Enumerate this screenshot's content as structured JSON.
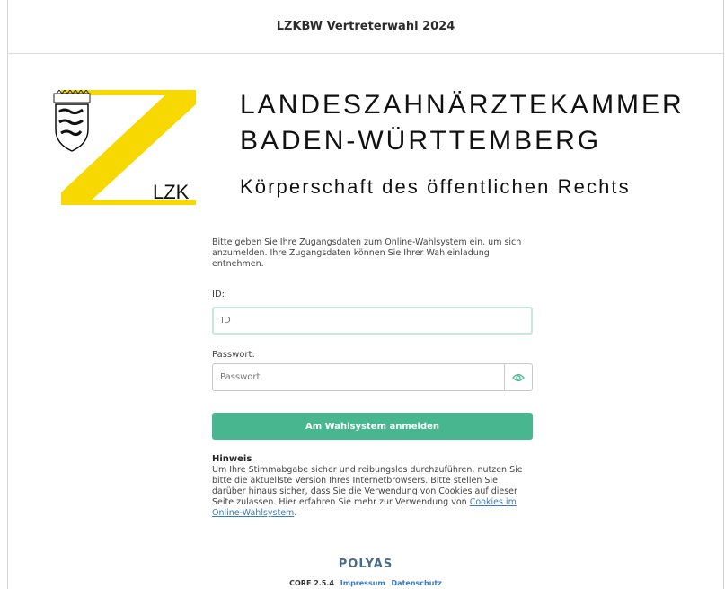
{
  "header": {
    "title": "LZKBW Vertreterwahl 2024"
  },
  "logo": {
    "text": "LZK",
    "brand_color": "#f7d800"
  },
  "organization": {
    "line1": "LANDESZAHNÄRZTEKAMMER",
    "line2": "BADEN-WÜRTTEMBERG",
    "line3": "Körperschaft des öffentlichen Rechts"
  },
  "login": {
    "intro": "Bitte geben Sie Ihre Zugangsdaten zum Online-Wahlsystem ein, um sich anzumelden. Ihre Zugangsdaten können Sie Ihrer Wahleinladung entnehmen.",
    "id_label": "ID:",
    "id_placeholder": "ID",
    "password_label": "Passwort:",
    "password_placeholder": "Passwort",
    "password_toggle_icon": "eye-icon",
    "submit_label": "Am Wahlsystem anmelden",
    "accent_color": "#48b68e"
  },
  "notice": {
    "title": "Hinweis",
    "text": "Um Ihre Stimmabgabe sicher und reibungslos durchzuführen, nutzen Sie bitte die aktuellste Version Ihres Internetbrowsers. Bitte stellen Sie darüber hinaus sicher, dass Sie die Verwendung von Cookies auf dieser Seite zulassen. Hier erfahren Sie mehr zur Verwendung von ",
    "link": "Cookies im Online-Wahlsystem",
    "suffix": "."
  },
  "footer": {
    "brand": "POLYAS",
    "version": "CORE 2.5.4",
    "impressum": "Impressum",
    "datenschutz": "Datenschutz"
  }
}
